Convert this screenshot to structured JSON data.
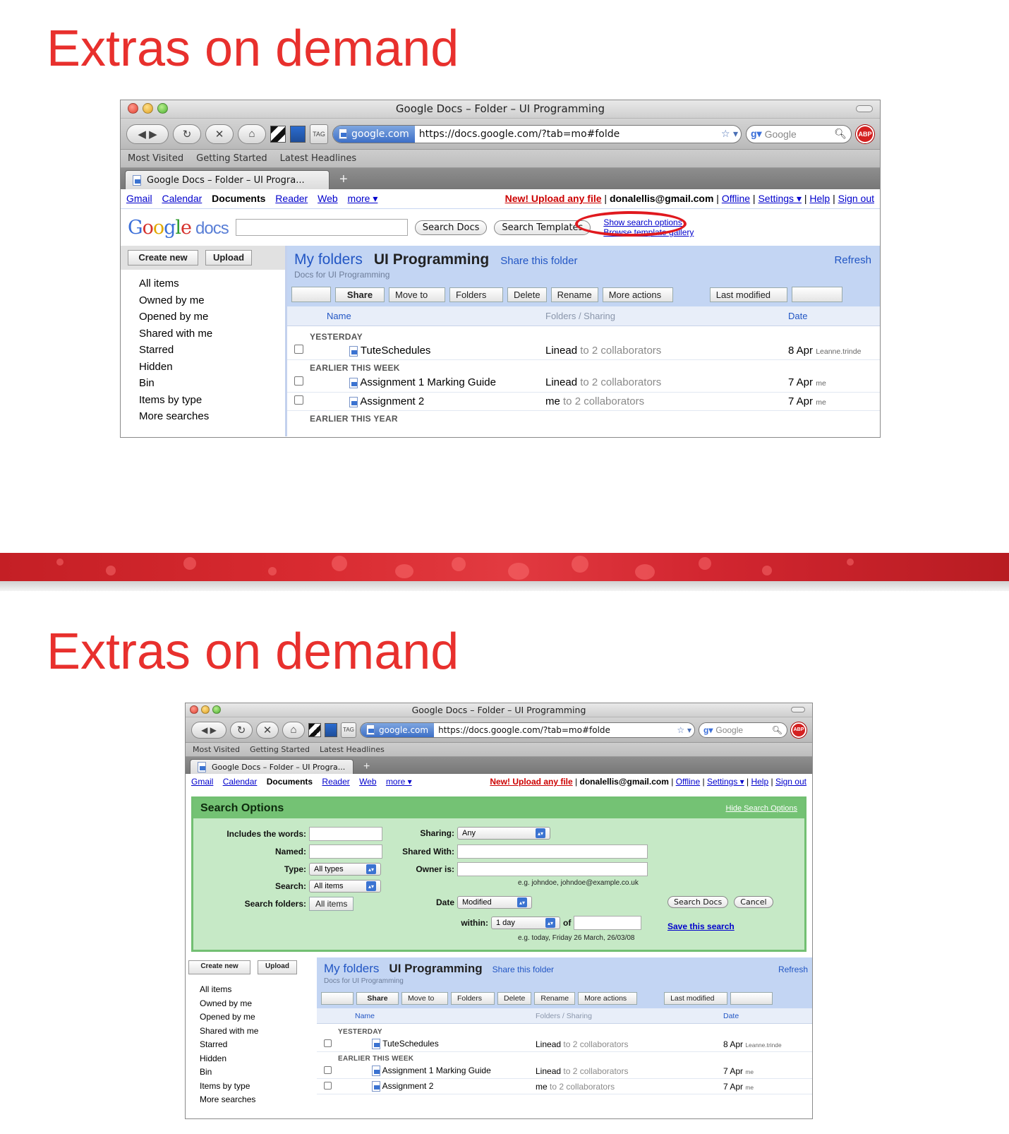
{
  "slides": [
    {
      "title": "Extras on demand"
    },
    {
      "title": "Extras on demand"
    }
  ],
  "browser": {
    "window_title": "Google Docs – Folder – UI Programming",
    "site_label": "google.com",
    "url": "https://docs.google.com/?tab=mo#folde",
    "search_engine": "Google",
    "abp_label": "ABP",
    "bookmarks": [
      "Most Visited",
      "Getting Started",
      "Latest Headlines"
    ],
    "tab_label": "Google Docs – Folder – UI Progra...",
    "new_tab": "+"
  },
  "google_bar": {
    "links": [
      "Gmail",
      "Calendar",
      "Documents",
      "Reader",
      "Web",
      "more ▾"
    ],
    "current": "Documents",
    "upload": "New! Upload any file",
    "email": "donalellis@gmail.com",
    "right_links": [
      "Offline",
      "Settings ▾",
      "Help",
      "Sign out"
    ]
  },
  "search_row": {
    "logo_google": "Google",
    "logo_docs": "docs",
    "search_docs": "Search Docs",
    "search_templates": "Search Templates",
    "show_search_options": "Show search options",
    "browse_gallery": "Browse template gallery"
  },
  "search_options": {
    "title": "Search Options",
    "hide": "Hide Search Options",
    "includes_label": "Includes the words:",
    "named_label": "Named:",
    "type_label": "Type:",
    "type_value": "All types",
    "search_label": "Search:",
    "search_value": "All items",
    "folders_label": "Search folders:",
    "folders_value": "All items",
    "sharing_label": "Sharing:",
    "sharing_value": "Any",
    "shared_with_label": "Shared With:",
    "owner_label": "Owner is:",
    "owner_hint": "e.g. johndoe, johndoe@example.co.uk",
    "date_label": "Date",
    "date_value": "Modified",
    "within_label": "within:",
    "within_value": "1 day",
    "of_label": "of",
    "date_hint": "e.g. today, Friday 26 March, 26/03/08",
    "search_btn": "Search Docs",
    "cancel_btn": "Cancel",
    "save_search": "Save this search"
  },
  "sidebar": {
    "create_new": "Create new",
    "upload": "Upload",
    "items": [
      "All items",
      "Owned by me",
      "Opened by me",
      "Shared with me",
      "Starred",
      "Hidden",
      "Bin",
      "Items by type",
      "More searches"
    ]
  },
  "folder": {
    "my_folders": "My folders",
    "name": "UI Programming",
    "share": "Share this folder",
    "refresh": "Refresh",
    "subtitle": "Docs for UI Programming"
  },
  "toolbar": [
    "Share",
    "Move to",
    "Folders",
    "Delete",
    "Rename",
    "More actions",
    "Last modified"
  ],
  "columns": {
    "name": "Name",
    "sharing": "Folders / Sharing",
    "date": "Date"
  },
  "groups": {
    "yesterday": "YESTERDAY",
    "this_week": "EARLIER THIS WEEK",
    "this_year": "EARLIER THIS YEAR"
  },
  "docs": [
    {
      "name": "TuteSchedules",
      "owner": "Linead",
      "sharing": "to 2 collaborators",
      "date": "8 Apr",
      "by": "Leanne.trinde"
    },
    {
      "name": "Assignment 1 Marking Guide",
      "owner": "Linead",
      "sharing": "to 2 collaborators",
      "date": "7 Apr",
      "by": "me"
    },
    {
      "name": "Assignment 2",
      "owner": "me",
      "sharing": "to 2 collaborators",
      "date": "7 Apr",
      "by": "me"
    }
  ],
  "colors": {
    "accent_red": "#e8302d",
    "folder_blue": "#c3d5f3",
    "options_green": "#c6e9c6"
  }
}
